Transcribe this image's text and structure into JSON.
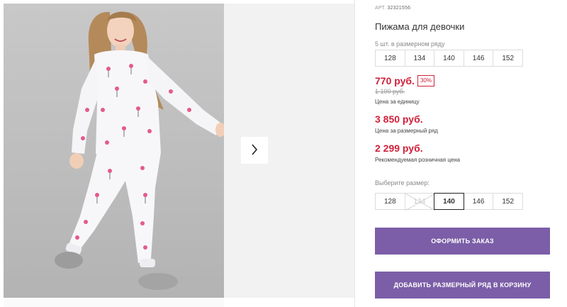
{
  "product": {
    "sku_label": "АРТ.",
    "sku_value": "32321556",
    "title": "Пижама для девочки",
    "pack_label": "5 шт. в размерном ряду",
    "pack_sizes": [
      "128",
      "134",
      "140",
      "146",
      "152"
    ],
    "price": "770 руб.",
    "discount": "30%",
    "old_price": "1 100 руб.",
    "unit_caption": "Цена за единицу",
    "pack_price": "3 850 руб.",
    "pack_caption": "Цена за размерный ряд",
    "retail_price": "2 299 руб.",
    "retail_caption": "Рекомендуемая розничная цена",
    "choose_size_label": "Выберите размер:",
    "select_sizes": [
      {
        "label": "128",
        "state": "available"
      },
      {
        "label": "134",
        "state": "unavailable"
      },
      {
        "label": "140",
        "state": "selected"
      },
      {
        "label": "146",
        "state": "available"
      },
      {
        "label": "152",
        "state": "available"
      }
    ]
  },
  "actions": {
    "order_label": "ОФОРМИТЬ ЗАКАЗ",
    "add_pack_label": "ДОБАВИТЬ РАЗМЕРНЫЙ РЯД В КОРЗИНУ"
  },
  "gallery": {
    "next_icon": "chevron-right-icon"
  },
  "colors": {
    "accent": "#7b5ea7",
    "price": "#d0203a"
  }
}
